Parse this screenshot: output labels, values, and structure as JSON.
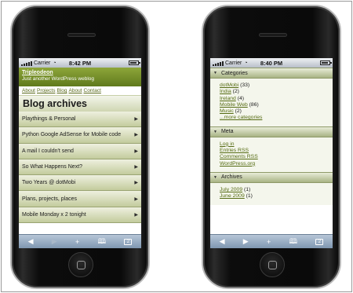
{
  "left_phone": {
    "status": {
      "carrier": "Carrier",
      "time": "8:42 PM"
    },
    "blog": {
      "title": "Tripleodeon",
      "tagline": "Just another WordPress weblog"
    },
    "nav": [
      "About",
      "Projects",
      "Blog",
      "About",
      "Contact"
    ],
    "page_title": "Blog archives",
    "posts": [
      "Playthings & Personal",
      "Python Google AdSense for Mobile code",
      "A mail I couldn't send",
      "So What Happens Next?",
      "Two Years @ dotMobi",
      "Plans, projects, places",
      "Mobile Monday x 2 tonight"
    ],
    "arrow": "▶"
  },
  "right_phone": {
    "status": {
      "carrier": "Carrier",
      "time": "8:40 PM"
    },
    "sections": {
      "categories": {
        "title": "Categories",
        "items": [
          {
            "name": "dotMobi",
            "count": "(33)"
          },
          {
            "name": "India",
            "count": "(2)"
          },
          {
            "name": "Ireland",
            "count": "(4)"
          },
          {
            "name": "Mobile Web",
            "count": "(86)"
          },
          {
            "name": "Music",
            "count": "(2)"
          }
        ],
        "more": "...more categories"
      },
      "meta": {
        "title": "Meta",
        "items": [
          "Log in",
          "Entries RSS",
          "Comments RSS",
          "WordPress.org"
        ]
      },
      "archives": {
        "title": "Archives",
        "items": [
          {
            "name": "July 2009",
            "count": "(1)"
          },
          {
            "name": "June 2009",
            "count": "(1)"
          }
        ]
      }
    }
  },
  "toolbar": {
    "back": "◀",
    "forward": "▶",
    "add": "+",
    "bookmarks": "📖",
    "pages": "2"
  },
  "colors": {
    "accent": "#6f8a2a",
    "toolbar": "#8fa5bd"
  }
}
